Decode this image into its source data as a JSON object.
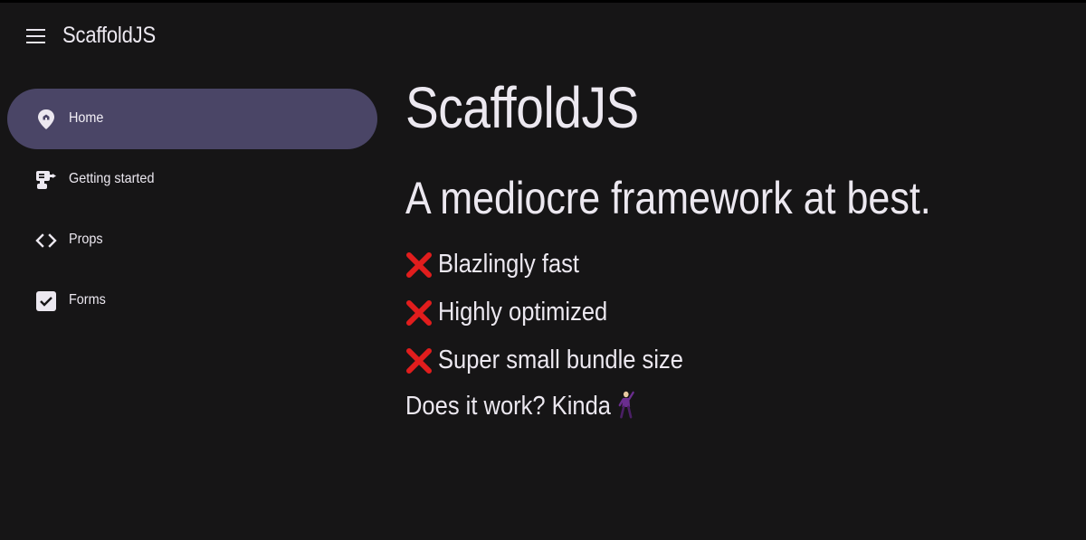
{
  "appbar": {
    "menu_icon": "menu-icon",
    "title": "ScaffoldJS"
  },
  "sidebar": {
    "items": [
      {
        "label": "Home",
        "icon": "home-pin-icon",
        "active": true
      },
      {
        "label": "Getting started",
        "icon": "robot-icon",
        "active": false
      },
      {
        "label": "Props",
        "icon": "code-icon",
        "active": false
      },
      {
        "label": "Forms",
        "icon": "checkbox-icon",
        "active": false
      }
    ]
  },
  "main": {
    "title": "ScaffoldJS",
    "subtitle": "A mediocre framework at best.",
    "features": [
      {
        "icon": "cross-mark-icon",
        "text": "Blazlingly fast"
      },
      {
        "icon": "cross-mark-icon",
        "text": "Highly optimized"
      },
      {
        "icon": "cross-mark-icon",
        "text": "Super small bundle size"
      }
    ],
    "question": "Does it work? Kinda",
    "question_icon": "dancing-man-icon"
  },
  "colors": {
    "background": "#161516",
    "active_nav": "#4a4566",
    "text": "#ece8f0",
    "cross": "#e11d1d"
  }
}
